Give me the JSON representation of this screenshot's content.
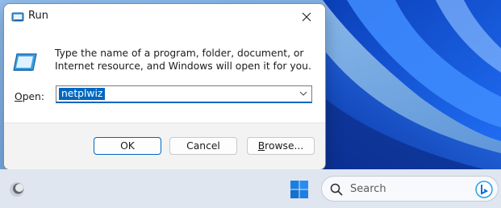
{
  "dialog": {
    "title": "Run",
    "description": "Type the name of a program, folder, document, or Internet resource, and Windows will open it for you.",
    "open_label_accel": "O",
    "open_label_rest": "pen:",
    "open_value": "netplwiz",
    "buttons": {
      "ok": "OK",
      "cancel": "Cancel",
      "browse_accel": "B",
      "browse_rest": "rowse..."
    }
  },
  "taskbar": {
    "search_placeholder": "Search"
  },
  "icons": {
    "title": "run-icon",
    "close": "close-icon",
    "dialog": "run-program-icon",
    "dropdown": "chevron-down-icon",
    "widgets": "widgets-icon",
    "start": "windows-start-icon",
    "search": "search-icon",
    "bing": "bing-icon"
  },
  "colors": {
    "accent": "#0067c0",
    "wallpaper": "#1e5fd6",
    "taskbar": "#dfe6f0"
  }
}
